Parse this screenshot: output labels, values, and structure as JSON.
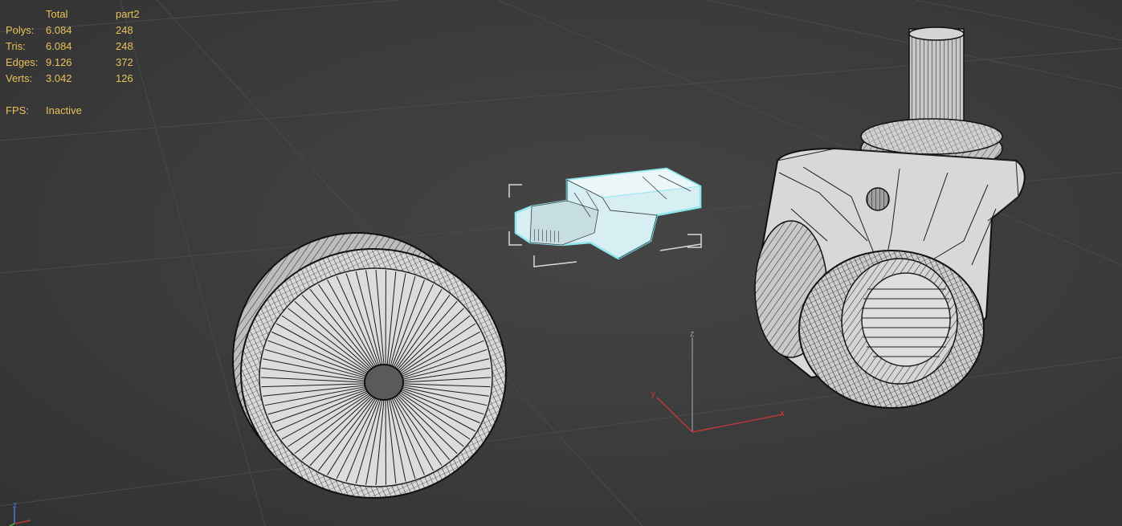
{
  "stats": {
    "header": {
      "total": "Total",
      "selection": "part2"
    },
    "rows": [
      {
        "label": "Polys:",
        "total": "6.084",
        "selection": "248"
      },
      {
        "label": "Tris:",
        "total": "6.084",
        "selection": "248"
      },
      {
        "label": "Edges:",
        "total": "9.126",
        "selection": "372"
      },
      {
        "label": "Verts:",
        "total": "3.042",
        "selection": "126"
      }
    ],
    "fps": {
      "label": "FPS:",
      "value": "Inactive"
    }
  },
  "gizmo": {
    "x": "x",
    "y": "y",
    "z": "z"
  },
  "corner_axis": {
    "z": "z"
  },
  "colors": {
    "stats_text": "#e8c15a",
    "selection": "#8fe7ee",
    "mesh_fill": "#d6d6d6",
    "wire": "#151515",
    "axis_x": "#b8383b",
    "axis_y": "#b8383b",
    "axis_z": "#9a9a9a"
  }
}
